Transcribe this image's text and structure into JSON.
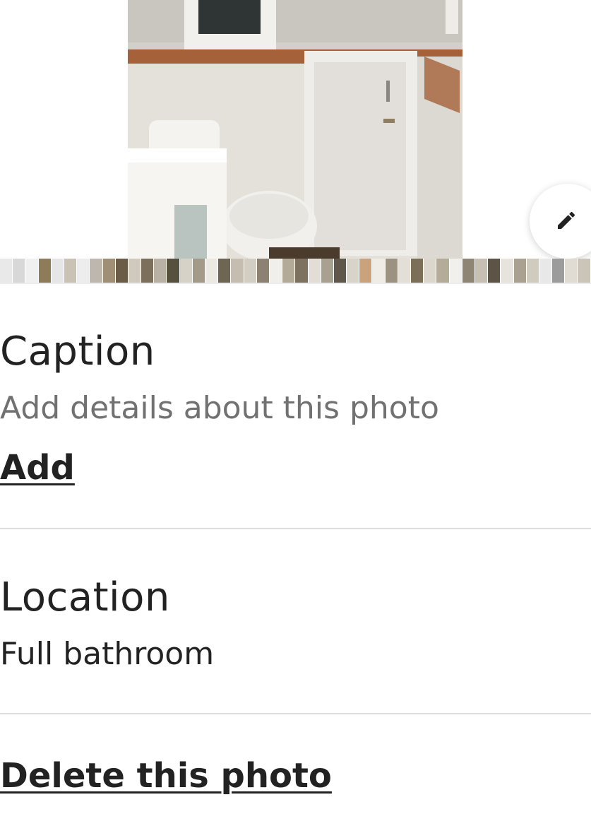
{
  "photo": {
    "description_icon": "bathroom-photo",
    "edit_icon": "pencil-icon"
  },
  "filmstrip": {
    "thumbnail_colors": [
      "#e9e9e9",
      "#d8d8d8",
      "#f0f0f0",
      "#8f7a5a",
      "#e6e6e6",
      "#c9c2b5",
      "#ededed",
      "#bdb7ad",
      "#9f8f76",
      "#6b5c48",
      "#cfc9be",
      "#7c6f5b",
      "#b8b1a4",
      "#57503f",
      "#d7d2c7",
      "#a49a89",
      "#ece9e3",
      "#6e6552",
      "#c4bdb0",
      "#d3cec4",
      "#8c8271",
      "#f1efeb",
      "#b3aa98",
      "#7d725f",
      "#e2ded6",
      "#a8a090",
      "#5e574a",
      "#d9d4ca",
      "#caa37c",
      "#efece6",
      "#9b927f",
      "#e4dfd6",
      "#7b6f58",
      "#dcd7cd",
      "#b4ab99",
      "#f2f0ec",
      "#8f8574",
      "#c7bfb1",
      "#5d5446",
      "#e7e4de",
      "#aaa190",
      "#d0cbbf",
      "#e8e8e8",
      "#9c9c9c",
      "#e0dcd4",
      "#cbc5b9"
    ]
  },
  "caption": {
    "title": "Caption",
    "placeholder": "Add details about this photo",
    "action": "Add"
  },
  "location": {
    "title": "Location",
    "value": "Full bathroom"
  },
  "delete": {
    "label": "Delete this photo"
  }
}
